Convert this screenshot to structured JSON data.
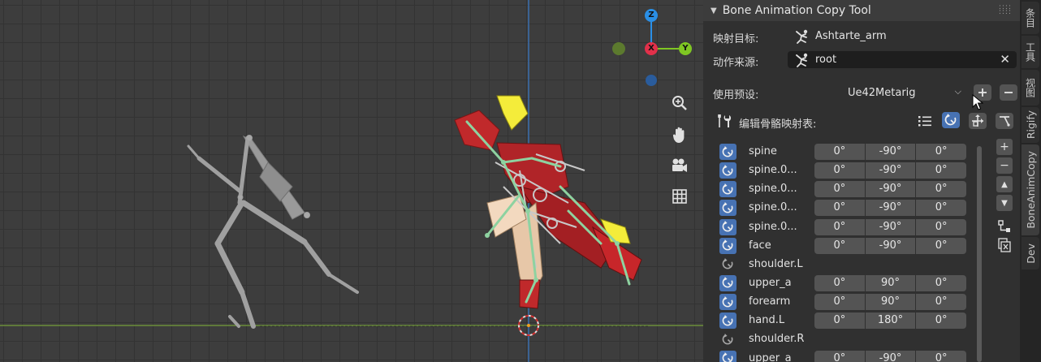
{
  "panel": {
    "title": "Bone Animation Copy Tool",
    "target_label": "映射目标:",
    "target_value": "Ashtarte_arm",
    "source_label": "动作来源:",
    "source_value": "root",
    "preset_label": "使用预设:",
    "preset_value": "Ue42Metarig",
    "edit_map_label": "编辑骨骼映射表:"
  },
  "bones": [
    {
      "name": "spine",
      "enabled": true,
      "x": "0°",
      "y": "-90°",
      "z": "0°"
    },
    {
      "name": "spine.0...",
      "enabled": true,
      "x": "0°",
      "y": "-90°",
      "z": "0°"
    },
    {
      "name": "spine.0...",
      "enabled": true,
      "x": "0°",
      "y": "-90°",
      "z": "0°"
    },
    {
      "name": "spine.0...",
      "enabled": true,
      "x": "0°",
      "y": "-90°",
      "z": "0°"
    },
    {
      "name": "spine.0...",
      "enabled": true,
      "x": "0°",
      "y": "-90°",
      "z": "0°"
    },
    {
      "name": "face",
      "enabled": true,
      "x": "0°",
      "y": "-90°",
      "z": "0°"
    },
    {
      "name": "shoulder.L",
      "enabled": false
    },
    {
      "name": "upper_a",
      "enabled": true,
      "x": "0°",
      "y": "90°",
      "z": "0°"
    },
    {
      "name": "forearm",
      "enabled": true,
      "x": "0°",
      "y": "90°",
      "z": "0°"
    },
    {
      "name": "hand.L",
      "enabled": true,
      "x": "0°",
      "y": "180°",
      "z": "0°"
    },
    {
      "name": "shoulder.R",
      "enabled": false
    },
    {
      "name": "upper_a",
      "enabled": true,
      "x": "0°",
      "y": "-90°",
      "z": "0°"
    }
  ],
  "tabs": [
    {
      "label": "条目",
      "cjk": true,
      "active": false
    },
    {
      "label": "工具",
      "cjk": true,
      "active": false
    },
    {
      "label": "视图",
      "cjk": true,
      "active": false
    },
    {
      "label": "Rigify",
      "cjk": false,
      "active": false
    },
    {
      "label": "BoneAnimCopy",
      "cjk": false,
      "active": true
    },
    {
      "label": "Dev",
      "cjk": false,
      "active": false
    }
  ],
  "gizmo": {
    "z": "Z",
    "x": "X",
    "y": "Y"
  },
  "colors": {
    "accent_blue": "#4772b3",
    "axis_x": "#e2304a",
    "axis_y": "#7fc623",
    "axis_z": "#2a8fe6",
    "bone_green": "#8ed2a0",
    "character_red": "#c0292b"
  },
  "icons": {
    "armature": "armature-icon",
    "clear": "close-icon",
    "add": "plus-icon",
    "remove": "minus-icon",
    "tools": "tools-icon"
  }
}
